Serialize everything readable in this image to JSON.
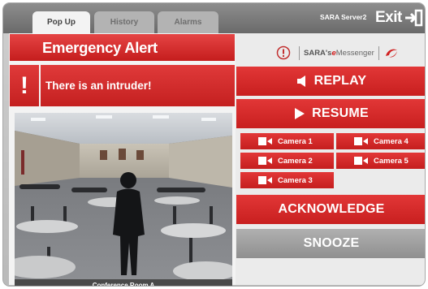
{
  "tabs": [
    {
      "label": "Pop Up",
      "active": true
    },
    {
      "label": "History",
      "active": false
    },
    {
      "label": "Alarms",
      "active": false
    }
  ],
  "header": {
    "server": "SARA Server2",
    "exit_label": "Exit"
  },
  "alert": {
    "title": "Emergency Alert",
    "message": "There is an intruder!",
    "icon": "exclamation-icon"
  },
  "camera_view": {
    "caption": "Conference Room A"
  },
  "branding": {
    "name_prefix": "SARA's ",
    "name_e": "e",
    "name_suffix": "Messenger"
  },
  "actions": {
    "replay": "REPLAY",
    "resume": "RESUME",
    "acknowledge": "ACKNOWLEDGE",
    "snooze": "SNOOZE"
  },
  "cameras": [
    {
      "label": "Camera 1"
    },
    {
      "label": "Camera 4"
    },
    {
      "label": "Camera 2"
    },
    {
      "label": "Camera 5"
    },
    {
      "label": "Camera 3"
    }
  ],
  "colors": {
    "accent_red": "#d12828",
    "neutral_gray": "#9e9e9e",
    "topbar": "#7a7a7a"
  }
}
